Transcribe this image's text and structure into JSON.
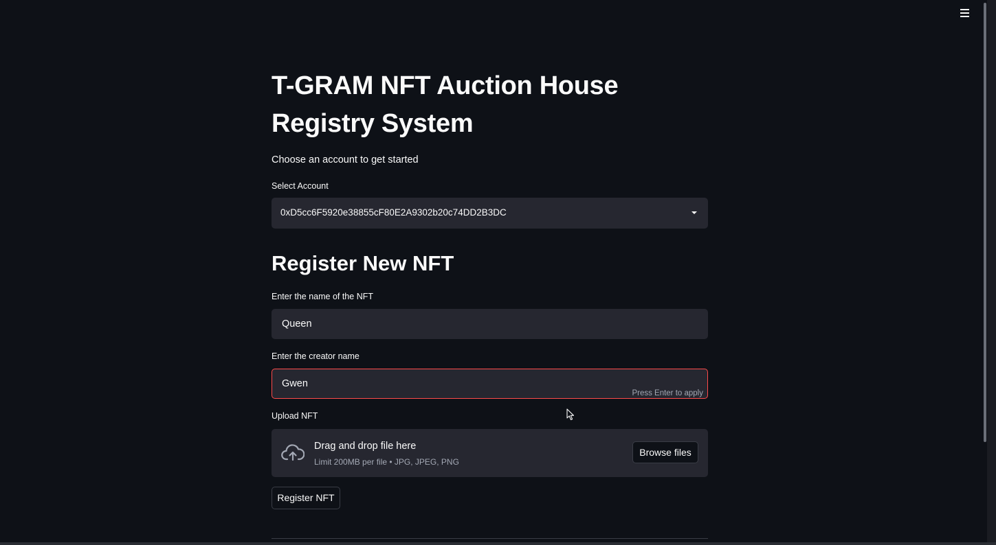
{
  "header": {
    "menu_icon": "hamburger-menu-icon"
  },
  "main": {
    "title": "T-GRAM NFT Auction House Registry System",
    "subtitle": "Choose an account to get started",
    "account_select": {
      "label": "Select Account",
      "value": "0xD5cc6F5920e38855cF80E2A9302b20c74DD2B3DC",
      "icon": "caret-down-icon"
    },
    "section_title": "Register New NFT",
    "nft_name": {
      "label": "Enter the name of the NFT",
      "value": "Queen"
    },
    "creator_name": {
      "label": "Enter the creator name",
      "value": "Gwen",
      "hint": "Press Enter to apply"
    },
    "upload": {
      "label": "Upload NFT",
      "icon": "cloud-upload-icon",
      "main_text": "Drag and drop file here",
      "sub_text": "Limit 200MB per file • JPG, JPEG, PNG",
      "browse_label": "Browse files"
    },
    "register_button": "Register NFT"
  },
  "colors": {
    "background": "#0e1117",
    "widget_bg": "#262730",
    "focus_border": "#ff4b4b",
    "text": "#fafafa",
    "muted_text": "#a3a8b4"
  }
}
